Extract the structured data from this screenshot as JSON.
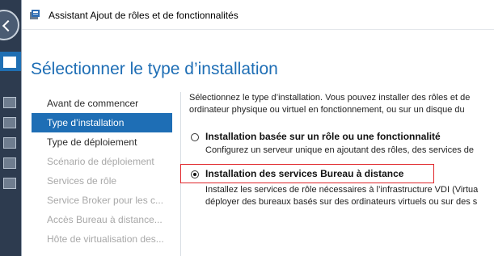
{
  "window": {
    "title": "Assistant Ajout de rôles et de fonctionnalités",
    "app_icon": "server-manager-icon"
  },
  "page": {
    "title": "Sélectionner le type d’installation"
  },
  "nav": {
    "items": [
      {
        "label": "Avant de commencer",
        "state": "normal"
      },
      {
        "label": "Type d’installation",
        "state": "active"
      },
      {
        "label": "Type de déploiement",
        "state": "normal"
      },
      {
        "label": "Scénario de déploiement",
        "state": "disabled"
      },
      {
        "label": "Services de rôle",
        "state": "disabled"
      },
      {
        "label": "Service Broker pour les c...",
        "state": "disabled"
      },
      {
        "label": "Accès Bureau à distance...",
        "state": "disabled"
      },
      {
        "label": "Hôte de virtualisation des...",
        "state": "disabled"
      }
    ]
  },
  "content": {
    "intro_line1": "Sélectionnez le type d’installation. Vous pouvez installer des rôles et de",
    "intro_line2": "ordinateur physique ou virtuel en fonctionnement, ou sur un disque du",
    "options": [
      {
        "label": "Installation basée sur un rôle ou une fonctionnalité",
        "desc_line1": "Configurez un serveur unique en ajoutant des rôles, des services de",
        "checked": false
      },
      {
        "label": "Installation des services Bureau à distance",
        "desc_line1": "Installez les services de rôle nécessaires à l’infrastructure VDI (Virtua",
        "desc_line2": "déployer des bureaux basés sur des ordinateurs virtuels ou sur des s",
        "checked": true
      }
    ]
  },
  "colors": {
    "accent": "#1e6eb5",
    "highlight_border": "#e0262b"
  }
}
